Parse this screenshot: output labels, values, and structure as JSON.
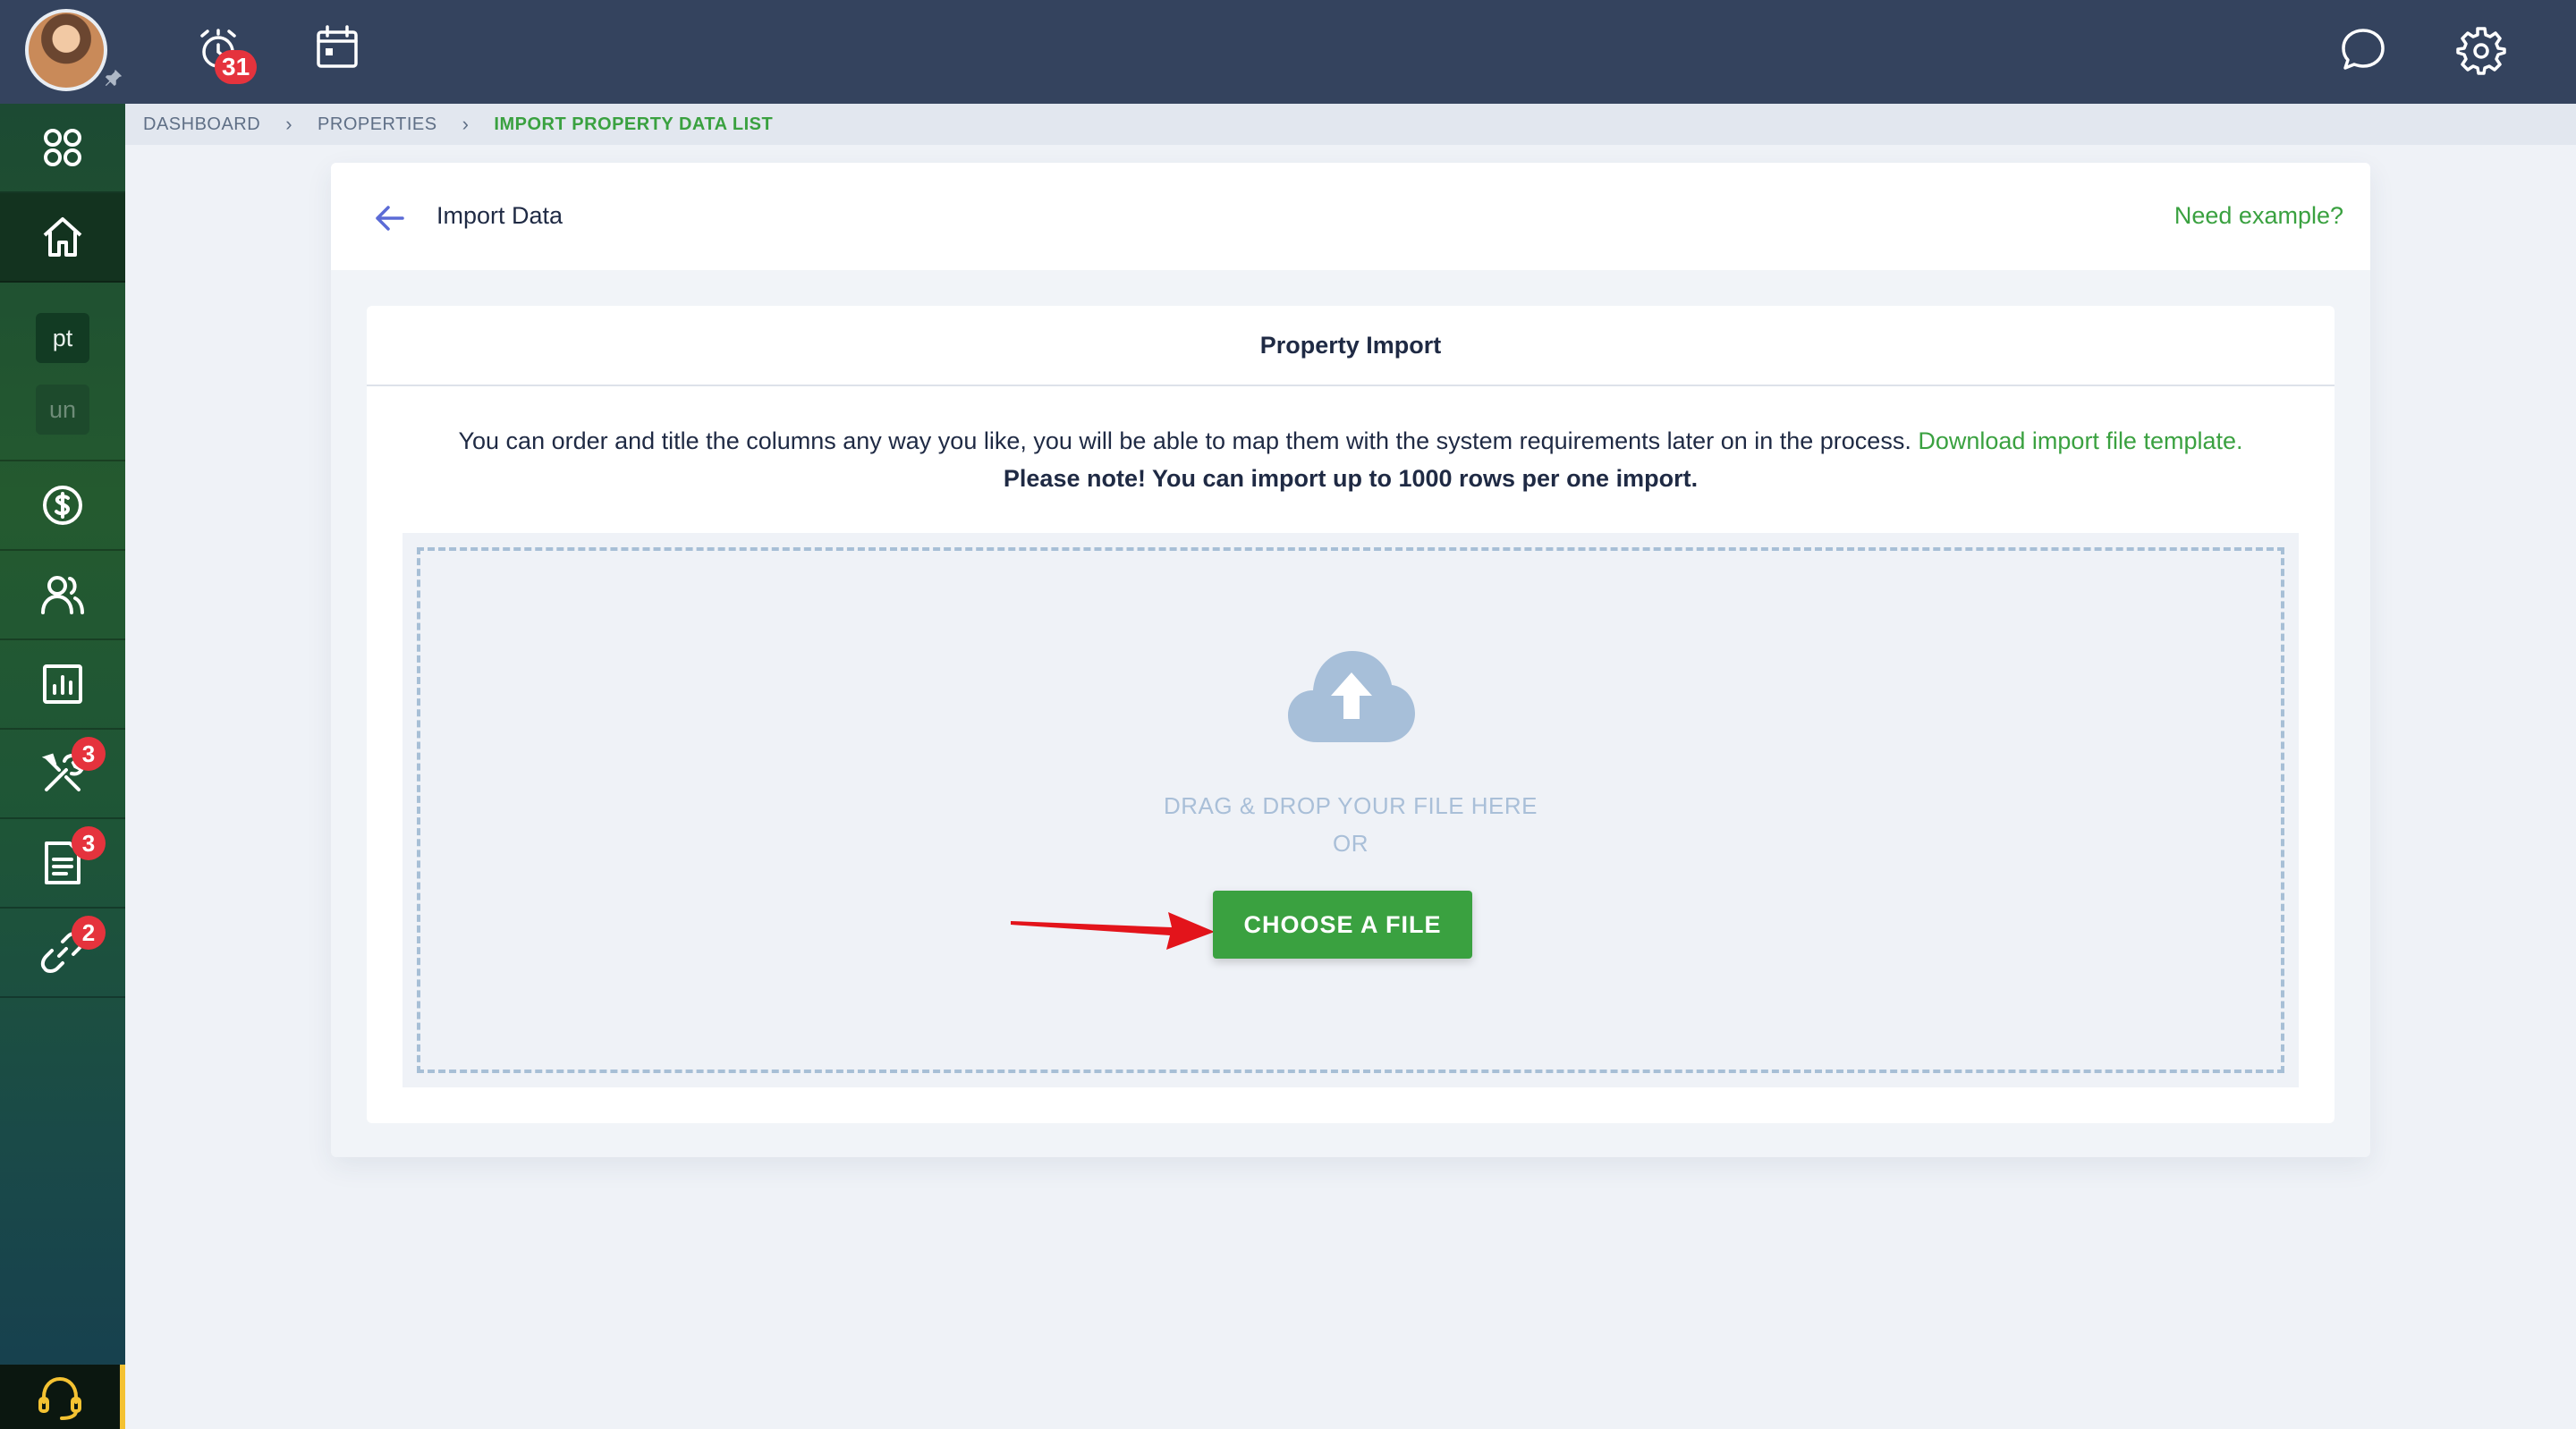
{
  "topbar": {
    "notifications_count": "31",
    "icons": [
      "avatar",
      "alarm-icon",
      "calendar-icon",
      "chat-icon",
      "settings-icon"
    ]
  },
  "sidebar": {
    "items": [
      {
        "name": "apps",
        "icon": "apps-grid-icon"
      },
      {
        "name": "home",
        "icon": "home-icon",
        "active": true
      },
      {
        "name": "tag-pt",
        "label": "pt"
      },
      {
        "name": "tag-un",
        "label": "un"
      },
      {
        "name": "finance",
        "icon": "dollar-icon"
      },
      {
        "name": "contacts",
        "icon": "users-icon"
      },
      {
        "name": "reports",
        "icon": "chart-icon"
      },
      {
        "name": "maintenance",
        "icon": "tools-icon",
        "badge": "3"
      },
      {
        "name": "documents",
        "icon": "document-icon",
        "badge": "3"
      },
      {
        "name": "integrations",
        "icon": "link-icon",
        "badge": "2"
      }
    ],
    "support_icon": "headset-icon"
  },
  "breadcrumb": {
    "items": [
      "DASHBOARD",
      "PROPERTIES",
      "IMPORT PROPERTY DATA LIST"
    ]
  },
  "header": {
    "title": "Import Data",
    "need_example": "Need example?"
  },
  "import": {
    "title": "Property Import",
    "instructions": "You can order and title the columns any way you like, you will be able to map them with the system requirements later on in the process.",
    "template_link": "Download import file template.",
    "note": "Please note! You can import up to 1000 rows per one import.",
    "drag_text": "DRAG & DROP YOUR FILE HERE",
    "or_text": "OR",
    "button_label": "CHOOSE A FILE"
  },
  "colors": {
    "accent": "#3aa140",
    "topbar": "#34435e",
    "badge": "#e5333d",
    "dropzone_text": "#a9bfd8"
  }
}
